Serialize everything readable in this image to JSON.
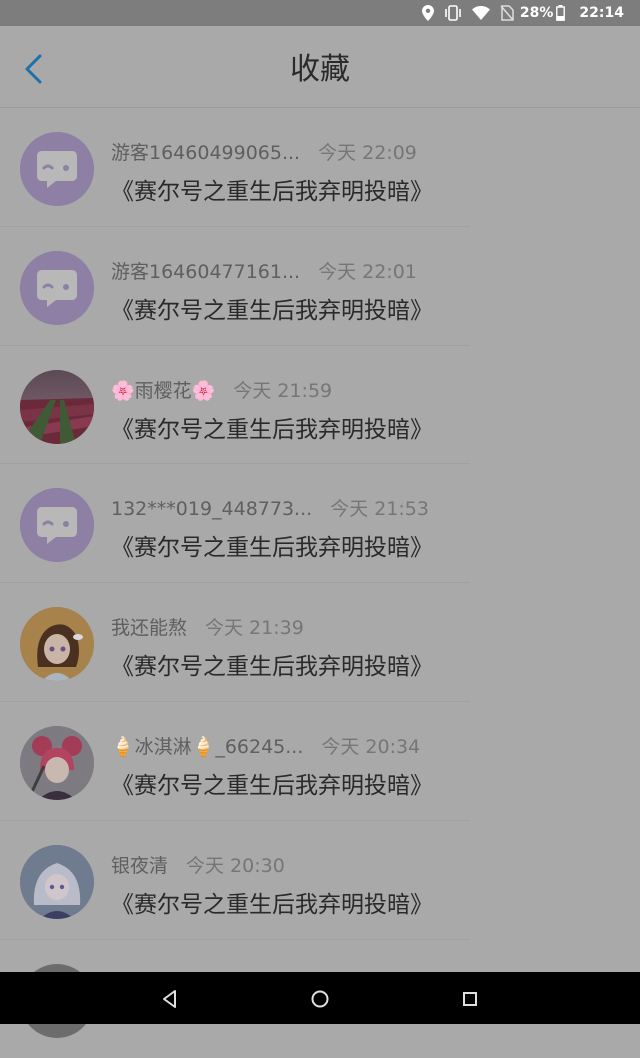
{
  "status_bar": {
    "battery": "28%",
    "time": "22:14",
    "icons": [
      "location-icon",
      "vibrate-icon",
      "wifi-icon",
      "no-sim-icon",
      "battery-icon"
    ]
  },
  "header": {
    "back_icon": "chevron-left-icon",
    "title": "收藏"
  },
  "items": [
    {
      "user": "游客16460499065...",
      "time": "今天 22:09",
      "title": "《赛尔号之重生后我弃明投暗》",
      "avatar": "default-chat"
    },
    {
      "user": "游客16460477161...",
      "time": "今天 22:01",
      "title": "《赛尔号之重生后我弃明投暗》",
      "avatar": "default-chat"
    },
    {
      "user": "🌸雨樱花🌸",
      "time": "今天 21:59",
      "title": "《赛尔号之重生后我弃明投暗》",
      "avatar": "tulip-field"
    },
    {
      "user": "132***019_448773...",
      "time": "今天 21:53",
      "title": "《赛尔号之重生后我弃明投暗》",
      "avatar": "default-chat"
    },
    {
      "user": "我还能熬",
      "time": "今天 21:39",
      "title": "《赛尔号之重生后我弃明投暗》",
      "avatar": "anime-girl-brown"
    },
    {
      "user": "🍦冰淇淋🍦_66245...",
      "time": "今天 20:34",
      "title": "《赛尔号之重生后我弃明投暗》",
      "avatar": "anime-girl-pink"
    },
    {
      "user": "银夜清",
      "time": "今天 20:30",
      "title": "《赛尔号之重生后我弃明投暗》",
      "avatar": "anime-girl-blue"
    }
  ],
  "nav_bar": {
    "icons": [
      "back-triangle-icon",
      "home-circle-icon",
      "recents-square-icon"
    ]
  }
}
